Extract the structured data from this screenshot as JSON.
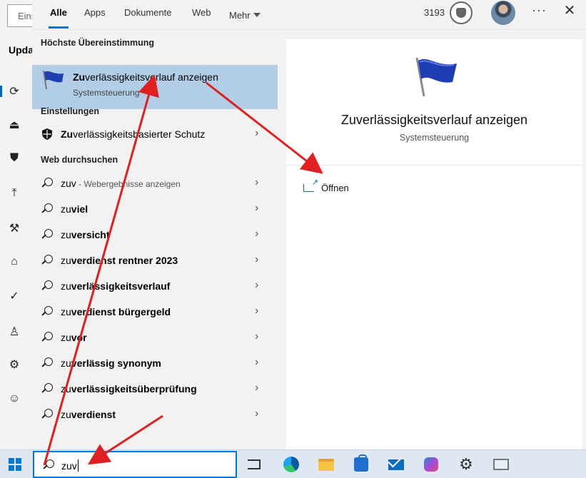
{
  "background_window": {
    "search_placeholder": "Eins",
    "title": "Upda"
  },
  "tabs": [
    {
      "label": "Alle",
      "active": true
    },
    {
      "label": "Apps",
      "active": false
    },
    {
      "label": "Dokumente",
      "active": false
    },
    {
      "label": "Web",
      "active": false
    },
    {
      "label": "Mehr",
      "active": false
    }
  ],
  "header": {
    "rewards_points": "3193"
  },
  "sections": {
    "best_match": "Höchste Übereinstimmung",
    "settings": "Einstellungen",
    "web": "Web durchsuchen"
  },
  "best_match": {
    "title_bold": "Zu",
    "title_rest": "verlässigkeitsverlauf anzeigen",
    "subtitle": "Systemsteuerung",
    "icon": "flag-icon"
  },
  "settings_results": [
    {
      "bold": "Zu",
      "rest": "verlässigkeitsbasierter Schutz",
      "icon": "shield-icon"
    }
  ],
  "web_results": [
    {
      "prefix": "zuv",
      "rest": "",
      "hint": " - Webergebnisse anzeigen"
    },
    {
      "prefix": "zu",
      "rest": "viel",
      "hint": ""
    },
    {
      "prefix": "zu",
      "rest": "versicht",
      "hint": ""
    },
    {
      "prefix": "zu",
      "rest": "verdienst rentner 2023",
      "hint": ""
    },
    {
      "prefix": "zu",
      "rest": "verlässigkeitsverlauf",
      "hint": ""
    },
    {
      "prefix": "zu",
      "rest": "verdienst bürgergeld",
      "hint": ""
    },
    {
      "prefix": "zu",
      "rest": "vor",
      "hint": ""
    },
    {
      "prefix": "zu",
      "rest": "verlässig synonym",
      "hint": ""
    },
    {
      "prefix": "zu",
      "rest": "verlässigkeitsüberprüfung",
      "hint": ""
    },
    {
      "prefix": "zu",
      "rest": "verdienst",
      "hint": ""
    }
  ],
  "preview": {
    "title": "Zuverlässigkeitsverlauf anzeigen",
    "subtitle": "Systemsteuerung",
    "open_label": "Öffnen"
  },
  "taskbar": {
    "search_value": "zuv",
    "apps": [
      "task-view-icon",
      "edge-icon",
      "file-explorer-icon",
      "store-icon",
      "mail-icon",
      "copilot-icon",
      "settings-gear-icon",
      "reliability-monitor-icon"
    ]
  },
  "colors": {
    "accent": "#0078d4",
    "selection": "#b2cde6",
    "annotation_arrow": "#e02020"
  }
}
